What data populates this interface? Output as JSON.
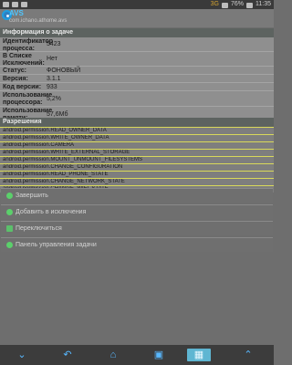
{
  "statusbar": {
    "time": "11:35",
    "battery": "76%",
    "network": "3G"
  },
  "app": {
    "name": "AVS",
    "package": "com.ichano.athome.avs"
  },
  "info": {
    "section_title": "Информация о задаче",
    "rows": [
      {
        "label": "Идентификатор процесса:",
        "value": "5423"
      },
      {
        "label": "В Списке Исключений:",
        "value": "Нет"
      },
      {
        "label": "Статус:",
        "value": "ФОНОВЫЙ"
      },
      {
        "label": "Версия:",
        "value": "3.1.1"
      },
      {
        "label": "Код версии:",
        "value": "933"
      },
      {
        "label": "Использование процессора:",
        "value": "5,2%"
      },
      {
        "label": "Использование памяти:",
        "value": "57,6Мб"
      }
    ]
  },
  "permissions": {
    "section_title": "Разрешения",
    "items": [
      "android.permission.READ_OWNER_DATA",
      "android.permission.WRITE_OWNER_DATA",
      "android.permission.CAMERA",
      "android.permission.WRITE_EXTERNAL_STORAGE",
      "android.permission.MOUNT_UNMOUNT_FILESYSTEMS",
      "android.permission.CHANGE_CONFIGURATION",
      "android.permission.READ_PHONE_STATE",
      "android.permission.CHANGE_NETWORK_STATE",
      "android.permission.CHANGE_WIFI_STATE"
    ]
  },
  "actions": [
    "Завершить",
    "Добавить в исключения",
    "Переключиться",
    "Панель управления задачи"
  ]
}
